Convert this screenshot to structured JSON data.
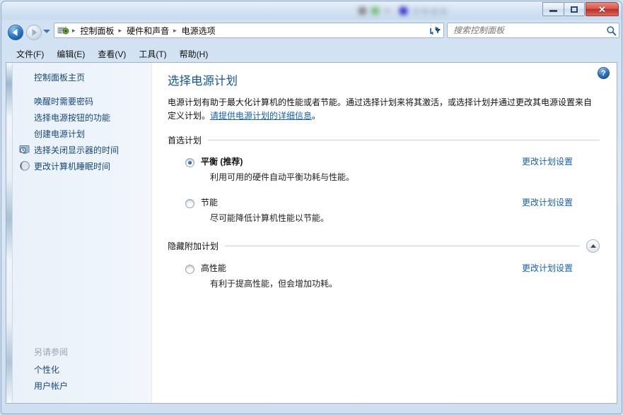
{
  "window": {
    "title_blurred": "控制面板",
    "controls": {
      "minimize_label": "最小化",
      "maximize_label": "最大化",
      "close_label": "关闭"
    }
  },
  "navbar": {
    "back_label": "后退",
    "forward_label": "前进",
    "history_label": "最近浏览的位置",
    "breadcrumb": {
      "icon": "control-panel-icon",
      "separator": "▸",
      "items": [
        "控制面板",
        "硬件和声音",
        "电源选项"
      ]
    },
    "breadcrumb_dropdown_label": "以前的位置",
    "refresh_label": "刷新",
    "search": {
      "placeholder": "搜索控制面板",
      "value": "",
      "icon": "search-icon"
    }
  },
  "menubar": {
    "items": [
      "文件(F)",
      "编辑(E)",
      "查看(V)",
      "工具(T)",
      "帮助(H)"
    ]
  },
  "sidebar": {
    "top_items": [
      {
        "label": "控制面板主页",
        "icon": ""
      },
      {
        "label": "唤醒时需要密码",
        "icon": ""
      },
      {
        "label": "选择电源按钮的功能",
        "icon": ""
      },
      {
        "label": "创建电源计划",
        "icon": ""
      },
      {
        "label": "选择关闭显示器的时间",
        "icon": "monitor-clock-icon"
      },
      {
        "label": "更改计算机睡眠时间",
        "icon": "moon-icon"
      }
    ],
    "see_also_heading": "另请参阅",
    "see_also_items": [
      "个性化",
      "用户帐户"
    ]
  },
  "main": {
    "help_label": "?",
    "page_title": "选择电源计划",
    "description_part1": "电源计划有助于最大化计算机的性能或者节能。通过选择计划来将其激活，或选择计划并通过更改其电源设置来自定义计划。",
    "description_link": "请提供电源计划的详细信息",
    "description_part2": "。",
    "groups": [
      {
        "heading": "首选计划",
        "collapsible": false,
        "plans": [
          {
            "name": "平衡 (推荐)",
            "recommended": true,
            "selected": true,
            "description": "利用可用的硬件自动平衡功耗与性能。",
            "action": "更改计划设置"
          },
          {
            "name": "节能",
            "recommended": false,
            "selected": false,
            "description": "尽可能降低计算机性能以节能。",
            "action": "更改计划设置"
          }
        ]
      },
      {
        "heading": "隐藏附加计划",
        "collapsible": true,
        "collapse_icon": "chevron-up-icon",
        "plans": [
          {
            "name": "高性能",
            "recommended": false,
            "selected": false,
            "description": "有利于提高性能，但会增加功耗。",
            "action": "更改计划设置"
          }
        ]
      }
    ]
  },
  "theme": {
    "accent_link": "#1560b0",
    "title_blue": "#12559e",
    "sidebar_link": "#14487e",
    "close_red": "#bb2e24",
    "sidebar_bg": "#eef4fb"
  }
}
